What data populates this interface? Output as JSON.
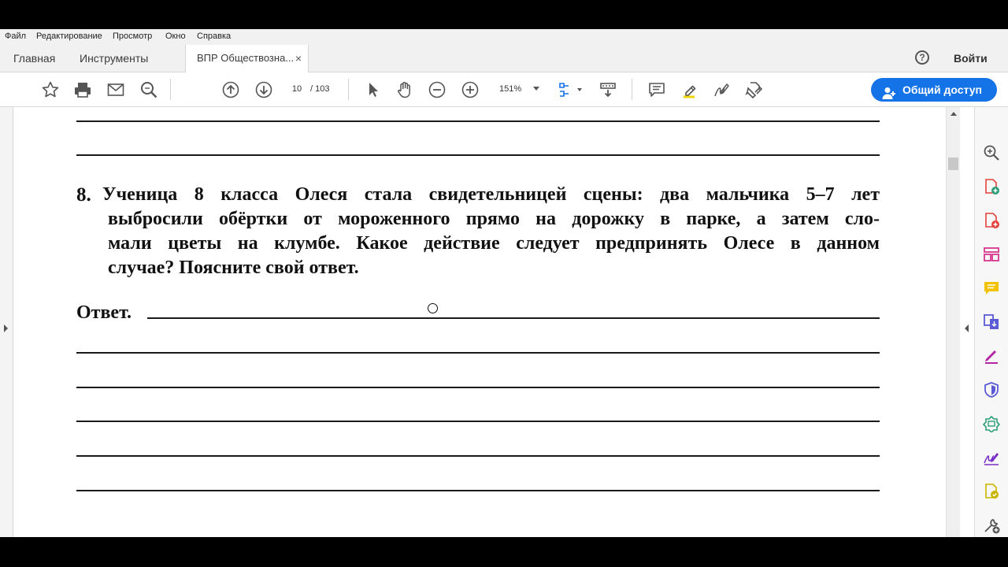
{
  "menu": [
    "Файл",
    "Редактирование",
    "Просмотр",
    "Окно",
    "Справка"
  ],
  "tabs": {
    "home": "Главная",
    "tools": "Инструменты",
    "document": "ВПР Обществозна...",
    "close": "×"
  },
  "help": "?",
  "sign_in": "Войти",
  "toolbar": {
    "page_current": "10",
    "page_total": "/ 103",
    "zoom": "151%",
    "share_label": "Общий доступ"
  },
  "accent_color": "#1473e6",
  "document": {
    "question_number": "8.",
    "question_lines": [
      "Ученица 8 класса Олеся стала свидетельницей сцены: два мальчика 5–7 лет",
      "выбросили обёртки от мороженного прямо на дорожку в парке, а затем сло-",
      "мали цветы на клумбе. Какое действие следует предпринять Олесе в данном",
      "случае? Поясните свой ответ."
    ],
    "answer_label": "Ответ."
  },
  "icons": {
    "toolbar": [
      "star-icon",
      "print-icon",
      "mail-icon",
      "search-icon",
      "page-up-icon",
      "page-down-icon",
      "select-cursor-icon",
      "hand-icon",
      "zoom-out-icon",
      "zoom-in-icon",
      "fit-page-icon",
      "scroll-mode-icon",
      "comment-icon",
      "highlight-icon",
      "sign-icon",
      "fill-sign-icon",
      "share-user-icon"
    ],
    "right_panel": [
      "enhance-scan-icon",
      "create-pdf-icon",
      "export-pdf-icon",
      "organize-pages-icon",
      "comment-tool-icon",
      "combine-files-icon",
      "fill-sign-tool-icon",
      "protect-icon",
      "optimize-pdf-icon",
      "request-signature-icon",
      "edit-pdf-icon",
      "more-tools-icon",
      "collapse-icon"
    ]
  }
}
